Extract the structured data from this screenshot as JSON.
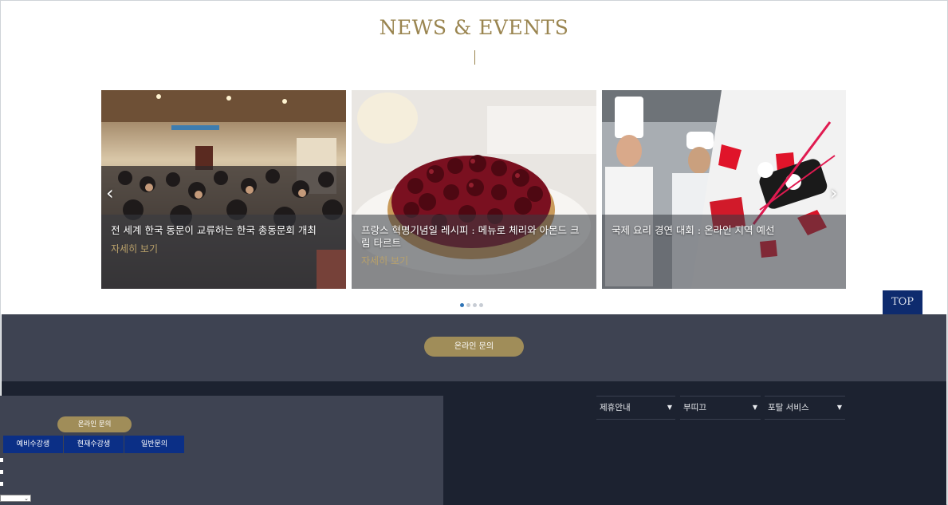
{
  "news": {
    "title": "NEWS & EVENTS",
    "cards": [
      {
        "caption": "전 세계 한국 동문이 교류하는 한국 총동문회 개최",
        "more": "자세히 보기"
      },
      {
        "caption": "프랑스 혁명기념일 레시피 : 메뉴로 체리와 아몬드 크림 타르트",
        "more": "자세히 보기"
      },
      {
        "caption": "국제 요리 경연 대회 : 온라인 지역 예선",
        "more": ""
      }
    ],
    "prev_icon": "‹",
    "next_icon": "›",
    "dots": 4
  },
  "top_button": "TOP",
  "inquiry": {
    "main_button": "온라인 문의",
    "panel_button": "온라인 문의",
    "tabs": [
      "예비수강생",
      "현재수강생",
      "일반문의"
    ],
    "select_caret": "⌄"
  },
  "footer_dropdowns": [
    {
      "label": "제휴안내",
      "icon": "caret-down-icon"
    },
    {
      "label": "부띠끄",
      "icon": "caret-down-icon"
    },
    {
      "label": "포탈 서비스",
      "icon": "caret-down-icon"
    }
  ],
  "colors": {
    "gold": "#9a8550",
    "navy": "#0e2b6e",
    "tab_blue": "#0b2f86",
    "band_gray": "#3e4352",
    "footer_dark": "#1c2230",
    "dot_active": "#2e74b7"
  }
}
